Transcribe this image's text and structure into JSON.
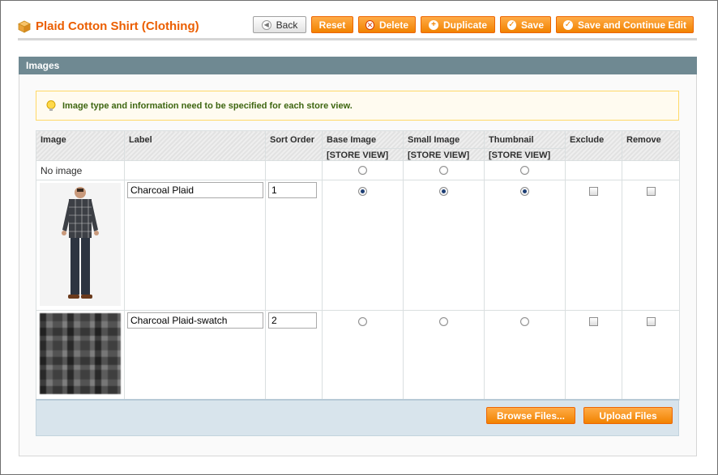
{
  "header": {
    "title": "Plaid Cotton Shirt (Clothing)",
    "buttons": {
      "back": "Back",
      "reset": "Reset",
      "delete": "Delete",
      "duplicate": "Duplicate",
      "save": "Save",
      "save_continue": "Save and Continue Edit"
    }
  },
  "section": {
    "title": "Images",
    "notice": "Image type and information need to be specified for each store view."
  },
  "grid": {
    "columns": {
      "image": "Image",
      "label": "Label",
      "sort_order": "Sort Order",
      "base_image": "Base Image",
      "small_image": "Small Image",
      "thumbnail": "Thumbnail",
      "exclude": "Exclude",
      "remove": "Remove",
      "scope": "[STORE VIEW]"
    },
    "no_image_label": "No image",
    "rows": [
      {
        "label": "Charcoal Plaid",
        "sort_order": "1",
        "base": true,
        "small": true,
        "thumb": true,
        "exclude": false,
        "remove": false
      },
      {
        "label": "Charcoal Plaid-swatch",
        "sort_order": "2",
        "base": false,
        "small": false,
        "thumb": false,
        "exclude": false,
        "remove": false
      }
    ]
  },
  "footer": {
    "browse": "Browse Files...",
    "upload": "Upload Files"
  },
  "colors": {
    "accent": "#eb5e00",
    "button_orange": "#f18200",
    "section_header": "#6f8992",
    "notice_text": "#3d6611"
  }
}
